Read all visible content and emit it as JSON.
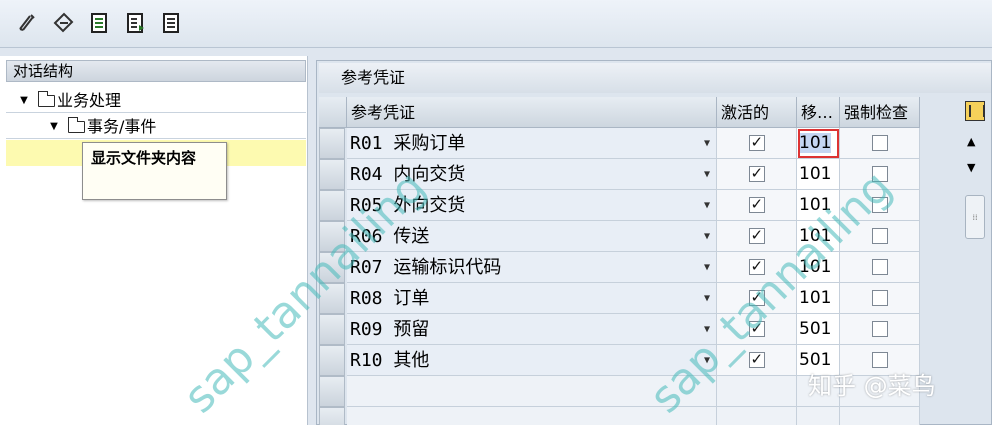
{
  "toolbar": {
    "buttons": [
      {
        "icon": "edit-pencil-icon"
      },
      {
        "icon": "display-change-icon"
      },
      {
        "icon": "document-save-icon"
      },
      {
        "icon": "document-export-icon"
      },
      {
        "icon": "document-list-icon"
      }
    ]
  },
  "dialog_structure": {
    "title": "对话结构",
    "nodes": [
      {
        "label": "业务处理"
      },
      {
        "label": "事务/事件"
      }
    ],
    "tooltip": "显示文件夹内容"
  },
  "ref_docs": {
    "title": "参考凭证",
    "columns": {
      "doc": "参考凭证",
      "active": "激活的",
      "movement": "移…",
      "mandatory": "强制检查"
    },
    "rows": [
      {
        "doc": "R01 采购订单",
        "active": true,
        "movement": "101",
        "mandatory": false
      },
      {
        "doc": "R04 内向交货",
        "active": true,
        "movement": "101",
        "mandatory": false
      },
      {
        "doc": "R05 外向交货",
        "active": true,
        "movement": "101",
        "mandatory": false
      },
      {
        "doc": "R06 传送",
        "active": true,
        "movement": "101",
        "mandatory": false
      },
      {
        "doc": "R07 运输标识代码",
        "active": true,
        "movement": "101",
        "mandatory": false
      },
      {
        "doc": "R08 订单",
        "active": true,
        "movement": "101",
        "mandatory": false
      },
      {
        "doc": "R09 预留",
        "active": true,
        "movement": "501",
        "mandatory": false
      },
      {
        "doc": "R10 其他",
        "active": true,
        "movement": "501",
        "mandatory": false
      }
    ]
  },
  "watermarks": {
    "text": "sap_tannailing",
    "source": "知乎 @菜鸟"
  }
}
